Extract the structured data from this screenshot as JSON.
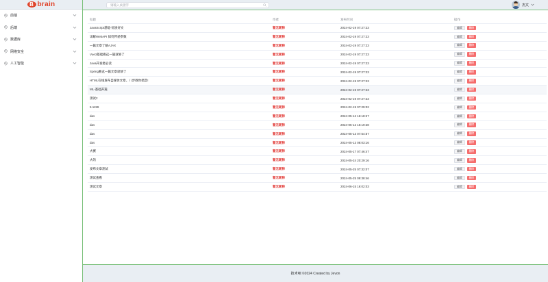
{
  "logo": {
    "letter": "B",
    "text": "brain"
  },
  "sidebar": {
    "items": [
      {
        "label": "前端"
      },
      {
        "label": "后端"
      },
      {
        "label": "数据库"
      },
      {
        "label": "网络安全"
      },
      {
        "label": "人工智能"
      }
    ]
  },
  "header": {
    "search_placeholder": "请输入关键字",
    "user_name": "杰文"
  },
  "table": {
    "columns": [
      "标题",
      "作者",
      "发布时间",
      "操作"
    ],
    "edit_label": "编辑",
    "delete_label": "删除",
    "rows": [
      {
        "title": "JavaScript基础-优质好文",
        "author": "暂无昵称",
        "time": "2024-02-19 07:27:23"
      },
      {
        "title": "详解WebAPI 如何传递参数",
        "author": "暂无昵称",
        "time": "2024-02-19 07:27:23"
      },
      {
        "title": "一篇文章了解AJAX",
        "author": "暂无昵称",
        "time": "2024-02-19 07:27:23"
      },
      {
        "title": "Vue3基础看这一篇就够了",
        "author": "暂无昵称",
        "time": "2024-02-19 07:27:23"
      },
      {
        "title": "Java开发者必读",
        "author": "暂无昵称",
        "time": "2024-02-19 07:27:23"
      },
      {
        "title": "Spring看这一篇文章就够了",
        "author": "暂无昵称",
        "time": "2024-02-19 07:27:23"
      },
      {
        "title": "HTML在线发布自媒体文章，八步教你搞定!",
        "author": "暂无昵称",
        "time": "2024-02-19 07:27:23"
      },
      {
        "title": "ML-基础开篇",
        "author": "暂无昵称",
        "time": "2024-02-19 07:27:23"
      },
      {
        "title": "测试2",
        "author": "暂无昵称",
        "time": "2024-02-19 07:27:23"
      },
      {
        "title": "5.1199",
        "author": "暂无昵称",
        "time": "2024-02-19 07:29:02"
      },
      {
        "title": "das",
        "author": "暂无昵称",
        "time": "2024-05-12 16:18:27"
      },
      {
        "title": "das",
        "author": "暂无昵称",
        "time": "2024-05-12 16:19:28"
      },
      {
        "title": "das",
        "author": "暂无昵称",
        "time": "2024-05-13 07:54:57"
      },
      {
        "title": "das",
        "author": "暂无昵称",
        "time": "2024-05-13 08:03:16"
      },
      {
        "title": "大赛",
        "author": "暂无昵称",
        "time": "2024-05-17 07:46:47"
      },
      {
        "title": "大的",
        "author": "暂无昵称",
        "time": "2024-05-24 20:29:16"
      },
      {
        "title": "发布文章测试",
        "author": "暂无昵称",
        "time": "2024-05-25 07:32:07"
      },
      {
        "title": "测试查看",
        "author": "暂无昵称",
        "time": "2024-05-25 09:38:46"
      },
      {
        "title": "测试文章",
        "author": "暂无昵称",
        "time": "2024-06-15 16:02:03"
      }
    ]
  },
  "footer": {
    "text": "技术吧 ©2024 Created by Jevon"
  },
  "colors": {
    "accent_red": "#e0302c",
    "delete_button": "#f56c6c",
    "header_bg": "#e9eef3",
    "border_green": "#7ec27e"
  }
}
